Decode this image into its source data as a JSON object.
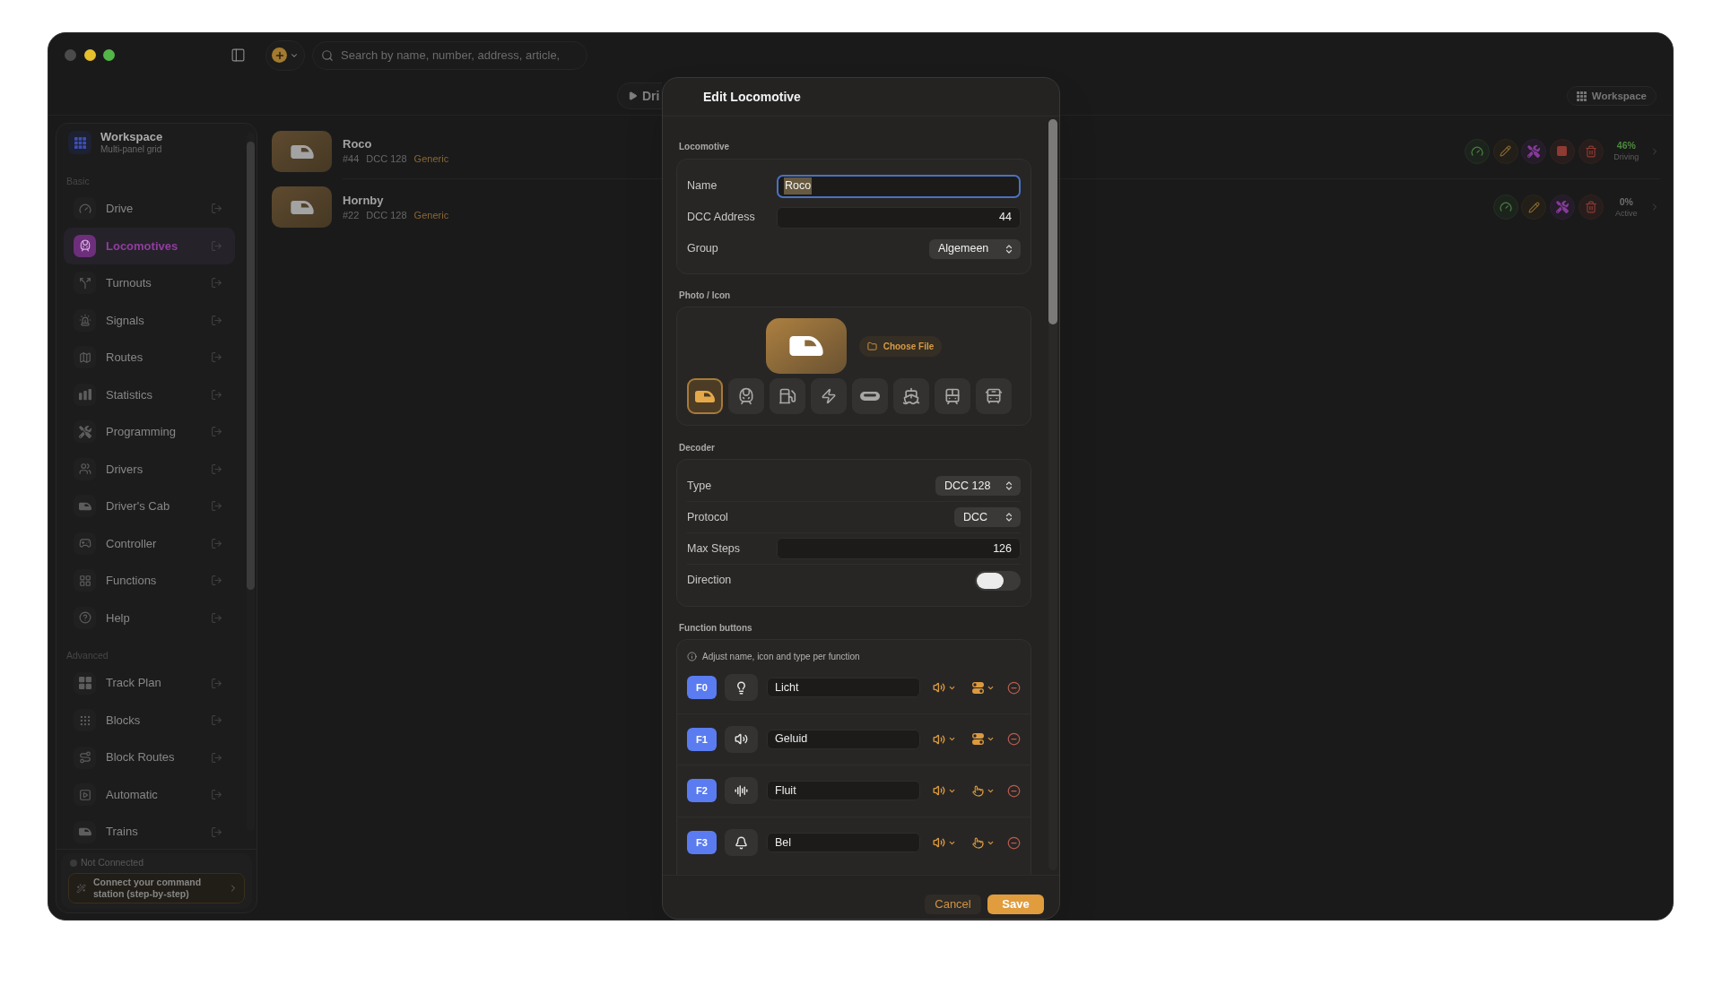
{
  "toolbar": {
    "search": {
      "placeholder": "Search by name, number, address, article,"
    }
  },
  "view_bar": {
    "drive_button": "Dri",
    "workspace_button": "Workspace"
  },
  "sidebar": {
    "workspace": {
      "title": "Workspace",
      "subtitle": "Multi-panel grid"
    },
    "groups": [
      {
        "label": "Basic",
        "items": [
          {
            "label": "Drive",
            "selected": false
          },
          {
            "label": "Locomotives",
            "selected": true
          },
          {
            "label": "Turnouts",
            "selected": false
          },
          {
            "label": "Signals",
            "selected": false
          },
          {
            "label": "Routes",
            "selected": false
          },
          {
            "label": "Statistics",
            "selected": false
          },
          {
            "label": "Programming",
            "selected": false
          },
          {
            "label": "Drivers",
            "selected": false
          },
          {
            "label": "Driver's Cab",
            "selected": false
          },
          {
            "label": "Controller",
            "selected": false
          },
          {
            "label": "Functions",
            "selected": false
          },
          {
            "label": "Help",
            "selected": false
          }
        ]
      },
      {
        "label": "Advanced",
        "items": [
          {
            "label": "Track Plan",
            "selected": false
          },
          {
            "label": "Blocks",
            "selected": false
          },
          {
            "label": "Block Routes",
            "selected": false
          },
          {
            "label": "Automatic",
            "selected": false
          },
          {
            "label": "Trains",
            "selected": false
          }
        ]
      }
    ],
    "connection": {
      "status": "Not Connected",
      "connected": false
    },
    "connect_button": "Connect your command station (step-by-step)"
  },
  "locomotives": [
    {
      "name": "Roco",
      "address": "#44",
      "decoder": "DCC 128",
      "tag": "Generic",
      "driving": true,
      "speed": "46%",
      "status": "Driving"
    },
    {
      "name": "Hornby",
      "address": "#22",
      "decoder": "DCC 128",
      "tag": "Generic",
      "driving": false,
      "speed": "0%",
      "status": "Active"
    }
  ],
  "dialog": {
    "title": "Edit Locomotive",
    "locomotive": {
      "label": "Locomotive",
      "name": {
        "label": "Name",
        "value": "Roco",
        "focused": true
      },
      "address": {
        "label": "DCC Address",
        "value": "44"
      },
      "group": {
        "label": "Group",
        "value": "Algemeen"
      }
    },
    "photo": {
      "label": "Photo / Icon",
      "choose_file": "Choose File",
      "icons": [
        {
          "selected": true
        },
        {
          "selected": false
        },
        {
          "selected": false
        },
        {
          "selected": false
        },
        {
          "selected": false
        },
        {
          "selected": false
        },
        {
          "selected": false
        },
        {
          "selected": false
        }
      ]
    },
    "decoder": {
      "label": "Decoder",
      "type": {
        "label": "Type",
        "value": "DCC 128"
      },
      "protocol": {
        "label": "Protocol",
        "value": "DCC"
      },
      "max_steps": {
        "label": "Max Steps",
        "value": "126"
      },
      "direction": {
        "label": "Direction",
        "on": false
      }
    },
    "functions": {
      "label": "Function buttons",
      "hint": "Adjust name, icon and type per function",
      "items": [
        {
          "key": "F0",
          "name": "Licht",
          "kind": "toggle"
        },
        {
          "key": "F1",
          "name": "Geluid",
          "kind": "toggle"
        },
        {
          "key": "F2",
          "name": "Fluit",
          "kind": "momentary"
        },
        {
          "key": "F3",
          "name": "Bel",
          "kind": "momentary"
        }
      ]
    },
    "buttons": {
      "cancel": "Cancel",
      "save": "Save"
    }
  }
}
